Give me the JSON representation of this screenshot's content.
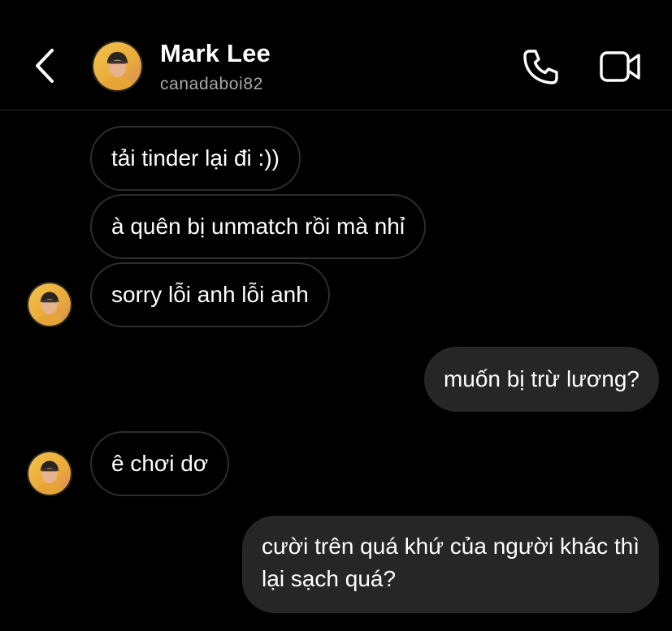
{
  "header": {
    "name": "Mark Lee",
    "username": "canadaboi82",
    "back_icon": "chevron-left-icon",
    "call_icon": "phone-icon",
    "video_icon": "video-camera-icon"
  },
  "colors": {
    "background": "#000000",
    "outgoing_bubble": "#262626",
    "incoming_border": "#2e2e2e",
    "secondary_text": "#a8a8a8"
  },
  "messages": [
    {
      "sender": "incoming",
      "text": "tải tinder lại đi :))"
    },
    {
      "sender": "incoming",
      "text": "à quên bị unmatch rồi mà nhỉ"
    },
    {
      "sender": "incoming",
      "text": "sorry lỗi anh lỗi anh"
    },
    {
      "sender": "outgoing",
      "text": "muốn bị trừ lương?"
    },
    {
      "sender": "incoming",
      "text": "ê chơi dơ"
    },
    {
      "sender": "outgoing",
      "lines": [
        "cười trên quá khứ của người khác thì",
        "lại sạch quá?"
      ]
    }
  ]
}
